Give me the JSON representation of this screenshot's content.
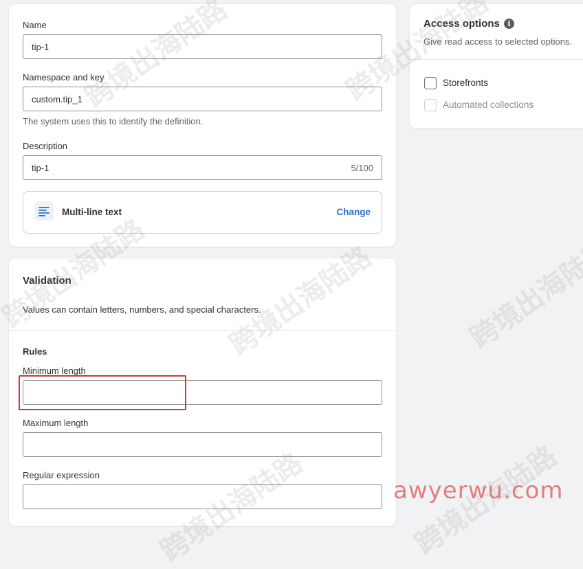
{
  "definition": {
    "name_label": "Name",
    "name_value": "tip-1",
    "namespace_label": "Namespace and key",
    "namespace_value": "custom.tip_1",
    "namespace_help": "The system uses this to identify the definition.",
    "description_label": "Description",
    "description_value": "tip-1",
    "description_counter": "5/100",
    "type_label": "Multi-line text",
    "type_icon": "text-lines-icon",
    "change_label": "Change"
  },
  "validation": {
    "title": "Validation",
    "description": "Values can contain letters, numbers, and special characters.",
    "rules_title": "Rules",
    "min_label": "Minimum length",
    "min_value": "",
    "max_label": "Maximum length",
    "max_value": "",
    "regex_label": "Regular expression",
    "regex_value": ""
  },
  "access": {
    "title": "Access options",
    "info_icon": "info-icon",
    "subtitle": "Give read access to selected options.",
    "options": [
      {
        "label": "Storefronts",
        "checked": false,
        "disabled": false
      },
      {
        "label": "Automated collections",
        "checked": false,
        "disabled": true
      }
    ]
  },
  "overlay": {
    "watermark_text": "跨境出海陆路",
    "site_text": "awyerwu.com",
    "highlight_color": "#d9342b"
  },
  "colors": {
    "link": "#2c6ecb",
    "background": "#f1f2f4",
    "border": "#8a8a8a"
  }
}
